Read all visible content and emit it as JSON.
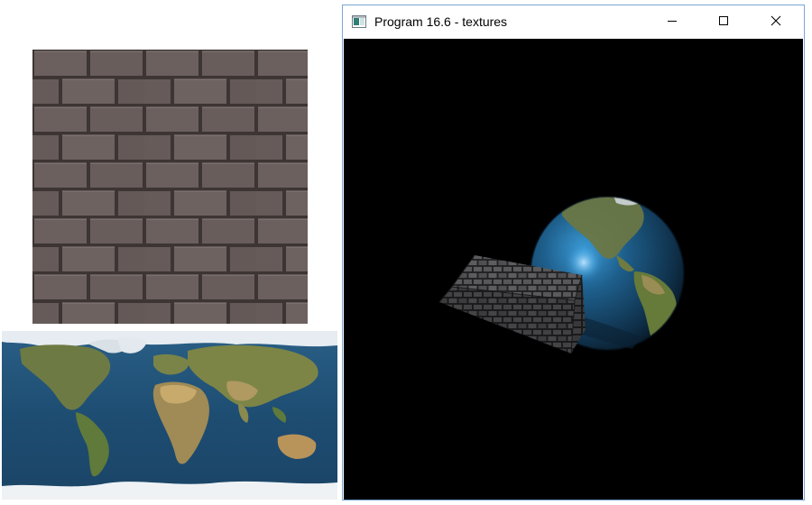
{
  "window": {
    "title": "Program 16.6 - textures",
    "controls": {
      "minimize": "minimize",
      "maximize": "maximize",
      "close": "close"
    }
  },
  "icons": [
    "app-icon",
    "minimize-icon",
    "maximize-icon",
    "close-icon"
  ],
  "colors": {
    "viewport_background": "#000000",
    "window_border": "#7aa7d6",
    "brick": "#5f5553",
    "ocean": "#1f4f74"
  }
}
